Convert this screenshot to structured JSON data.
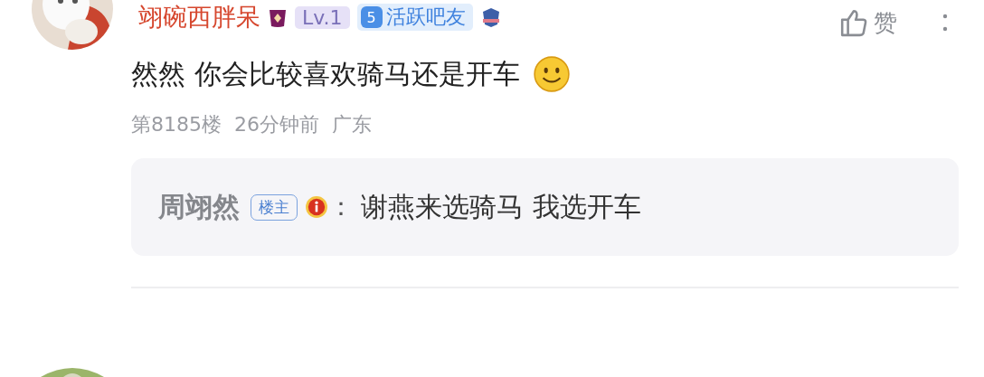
{
  "comment": {
    "author": {
      "name": "翊碗西胖呆",
      "level": "Lv.1",
      "fan_rank": "5",
      "fan_title": "活跃吧友"
    },
    "like_label": "赞",
    "text": "然然 你会比较喜欢骑马还是开车",
    "floor": "第8185楼",
    "time": "26分钟前",
    "location": "广东",
    "reply": {
      "author": "周翊然",
      "tag": "楼主",
      "separator": "：",
      "text": "谢燕来选骑马 我选开车"
    }
  }
}
